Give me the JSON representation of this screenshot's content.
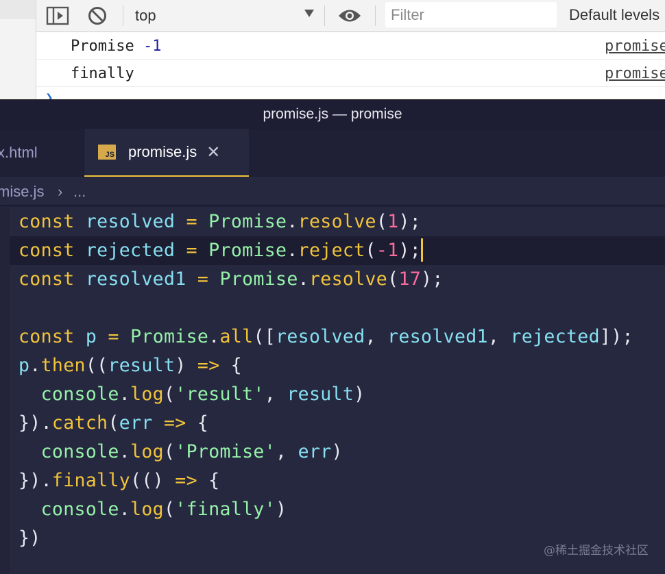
{
  "devtools": {
    "context": "top",
    "filter_placeholder": "Filter",
    "levels": "Default levels",
    "logs": [
      {
        "prefix": "Promise ",
        "value": "-1",
        "source": "promise"
      },
      {
        "prefix": "finally",
        "value": "",
        "source": "promise"
      }
    ]
  },
  "window": {
    "title": "promise.js — promise"
  },
  "tabs": [
    {
      "label": "x.html"
    },
    {
      "label": "promise.js",
      "icon_text": "JS"
    }
  ],
  "breadcrumb": {
    "file": "mise.js",
    "separator": "›",
    "rest": "..."
  },
  "code_lines": [
    [
      {
        "c": "k",
        "t": "const"
      },
      {
        "c": "p",
        "t": " "
      },
      {
        "c": "v",
        "t": "resolved"
      },
      {
        "c": "p",
        "t": " "
      },
      {
        "c": "o",
        "t": "="
      },
      {
        "c": "p",
        "t": " "
      },
      {
        "c": "c",
        "t": "Promise"
      },
      {
        "c": "p",
        "t": "."
      },
      {
        "c": "f",
        "t": "resolve"
      },
      {
        "c": "p",
        "t": "("
      },
      {
        "c": "n",
        "t": "1"
      },
      {
        "c": "p",
        "t": ");"
      }
    ],
    [
      {
        "c": "k",
        "t": "const"
      },
      {
        "c": "p",
        "t": " "
      },
      {
        "c": "v",
        "t": "rejected"
      },
      {
        "c": "p",
        "t": " "
      },
      {
        "c": "o",
        "t": "="
      },
      {
        "c": "p",
        "t": " "
      },
      {
        "c": "c",
        "t": "Promise"
      },
      {
        "c": "p",
        "t": "."
      },
      {
        "c": "f",
        "t": "reject"
      },
      {
        "c": "p",
        "t": "("
      },
      {
        "c": "n",
        "t": "-1"
      },
      {
        "c": "p",
        "t": ");"
      }
    ],
    [
      {
        "c": "k",
        "t": "const"
      },
      {
        "c": "p",
        "t": " "
      },
      {
        "c": "v",
        "t": "resolved1"
      },
      {
        "c": "p",
        "t": " "
      },
      {
        "c": "o",
        "t": "="
      },
      {
        "c": "p",
        "t": " "
      },
      {
        "c": "c",
        "t": "Promise"
      },
      {
        "c": "p",
        "t": "."
      },
      {
        "c": "f",
        "t": "resolve"
      },
      {
        "c": "p",
        "t": "("
      },
      {
        "c": "n",
        "t": "17"
      },
      {
        "c": "p",
        "t": ");"
      }
    ],
    [],
    [
      {
        "c": "k",
        "t": "const"
      },
      {
        "c": "p",
        "t": " "
      },
      {
        "c": "v",
        "t": "p"
      },
      {
        "c": "p",
        "t": " "
      },
      {
        "c": "o",
        "t": "="
      },
      {
        "c": "p",
        "t": " "
      },
      {
        "c": "c",
        "t": "Promise"
      },
      {
        "c": "p",
        "t": "."
      },
      {
        "c": "f",
        "t": "all"
      },
      {
        "c": "p",
        "t": "(["
      },
      {
        "c": "v",
        "t": "resolved"
      },
      {
        "c": "p",
        "t": ", "
      },
      {
        "c": "v",
        "t": "resolved1"
      },
      {
        "c": "p",
        "t": ", "
      },
      {
        "c": "v",
        "t": "rejected"
      },
      {
        "c": "p",
        "t": "]);"
      }
    ],
    [
      {
        "c": "v",
        "t": "p"
      },
      {
        "c": "p",
        "t": "."
      },
      {
        "c": "f",
        "t": "then"
      },
      {
        "c": "p",
        "t": "(("
      },
      {
        "c": "v",
        "t": "result"
      },
      {
        "c": "p",
        "t": ") "
      },
      {
        "c": "o",
        "t": "=>"
      },
      {
        "c": "p",
        "t": " {"
      }
    ],
    [
      {
        "c": "p",
        "t": "  "
      },
      {
        "c": "c",
        "t": "console"
      },
      {
        "c": "p",
        "t": "."
      },
      {
        "c": "f",
        "t": "log"
      },
      {
        "c": "p",
        "t": "("
      },
      {
        "c": "s",
        "t": "'result'"
      },
      {
        "c": "p",
        "t": ", "
      },
      {
        "c": "v",
        "t": "result"
      },
      {
        "c": "p",
        "t": ")"
      }
    ],
    [
      {
        "c": "p",
        "t": "})."
      },
      {
        "c": "f",
        "t": "catch"
      },
      {
        "c": "p",
        "t": "("
      },
      {
        "c": "v",
        "t": "err"
      },
      {
        "c": "p",
        "t": " "
      },
      {
        "c": "o",
        "t": "=>"
      },
      {
        "c": "p",
        "t": " {"
      }
    ],
    [
      {
        "c": "p",
        "t": "  "
      },
      {
        "c": "c",
        "t": "console"
      },
      {
        "c": "p",
        "t": "."
      },
      {
        "c": "f",
        "t": "log"
      },
      {
        "c": "p",
        "t": "("
      },
      {
        "c": "s",
        "t": "'Promise'"
      },
      {
        "c": "p",
        "t": ", "
      },
      {
        "c": "v",
        "t": "err"
      },
      {
        "c": "p",
        "t": ")"
      }
    ],
    [
      {
        "c": "p",
        "t": "})."
      },
      {
        "c": "f",
        "t": "finally"
      },
      {
        "c": "p",
        "t": "(() "
      },
      {
        "c": "o",
        "t": "=>"
      },
      {
        "c": "p",
        "t": " {"
      }
    ],
    [
      {
        "c": "p",
        "t": "  "
      },
      {
        "c": "c",
        "t": "console"
      },
      {
        "c": "p",
        "t": "."
      },
      {
        "c": "f",
        "t": "log"
      },
      {
        "c": "p",
        "t": "("
      },
      {
        "c": "s",
        "t": "'finally'"
      },
      {
        "c": "p",
        "t": ")"
      }
    ],
    [
      {
        "c": "p",
        "t": "})"
      }
    ]
  ],
  "watermark": "@稀土掘金技术社区"
}
